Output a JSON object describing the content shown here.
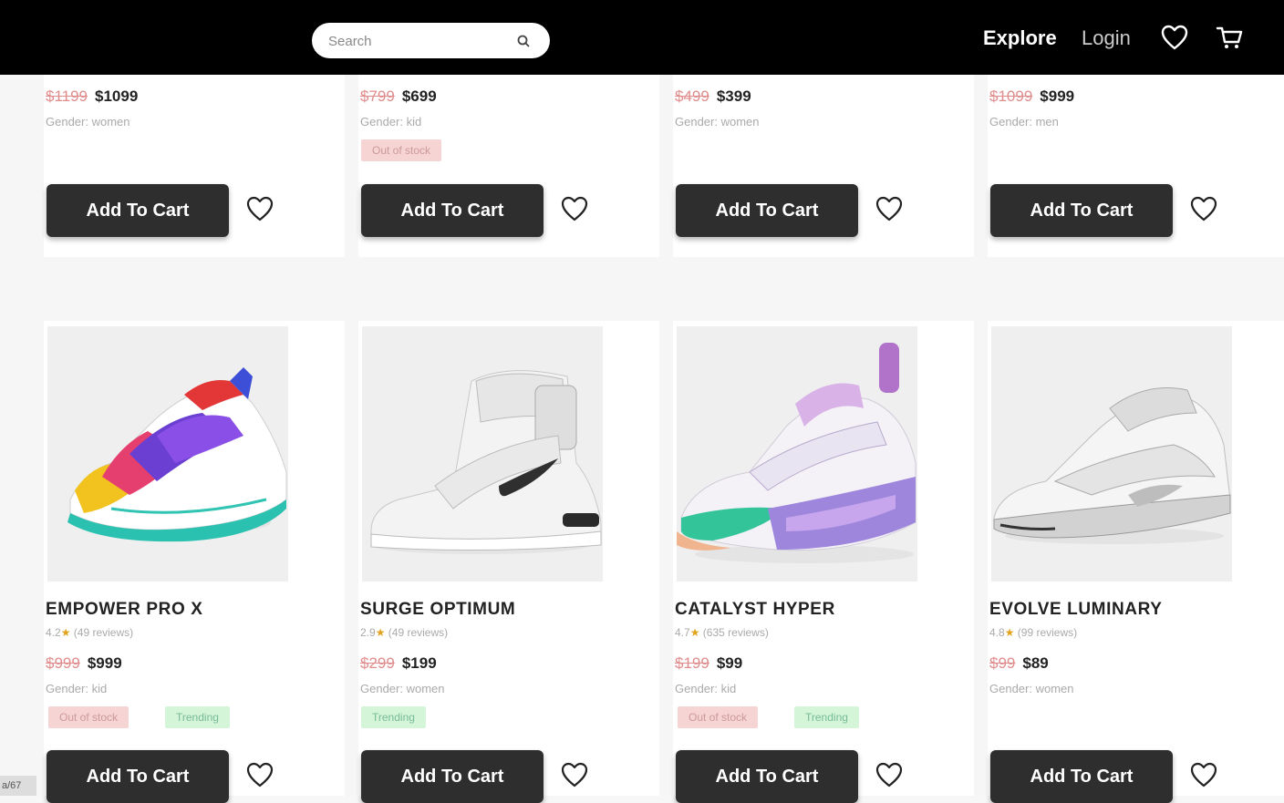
{
  "header": {
    "search_placeholder": "Search",
    "nav_explore": "Explore",
    "nav_login": "Login"
  },
  "top_row": [
    {
      "old_price": "$1199",
      "price": "$1099",
      "gender": "Gender: women",
      "badges": []
    },
    {
      "old_price": "$799",
      "price": "$699",
      "gender": "Gender: kid",
      "badges": [
        "Out of stock"
      ]
    },
    {
      "old_price": "$499",
      "price": "$399",
      "gender": "Gender: women",
      "badges": []
    },
    {
      "old_price": "$1099",
      "price": "$999",
      "gender": "Gender: men",
      "badges": []
    }
  ],
  "bottom_row": [
    {
      "name": "EMPOWER PRO X",
      "rating": "4.2",
      "reviews": "(49 reviews)",
      "old_price": "$999",
      "price": "$999",
      "gender": "Gender: kid",
      "badges": [
        "Out of stock",
        "Trending"
      ]
    },
    {
      "name": "SURGE OPTIMUM",
      "rating": "2.9",
      "reviews": "(49 reviews)",
      "old_price": "$299",
      "price": "$199",
      "gender": "Gender: women",
      "badges": [
        "Trending"
      ]
    },
    {
      "name": "CATALYST HYPER",
      "rating": "4.7",
      "reviews": "(635 reviews)",
      "old_price": "$199",
      "price": "$99",
      "gender": "Gender: kid",
      "badges": [
        "Out of stock",
        "Trending"
      ]
    },
    {
      "name": "EVOLVE LUMINARY",
      "rating": "4.8",
      "reviews": "(99 reviews)",
      "old_price": "$99",
      "price": "$89",
      "gender": "Gender: women",
      "badges": []
    }
  ],
  "add_to_cart_label": "Add To Cart",
  "pager_text": "a/67",
  "colors": {
    "header_bg": "#000000",
    "button_bg": "#2e2e2e",
    "oos_bg": "#f7d4d4",
    "trend_bg": "#d4f5d8",
    "star": "#e2a21b"
  }
}
